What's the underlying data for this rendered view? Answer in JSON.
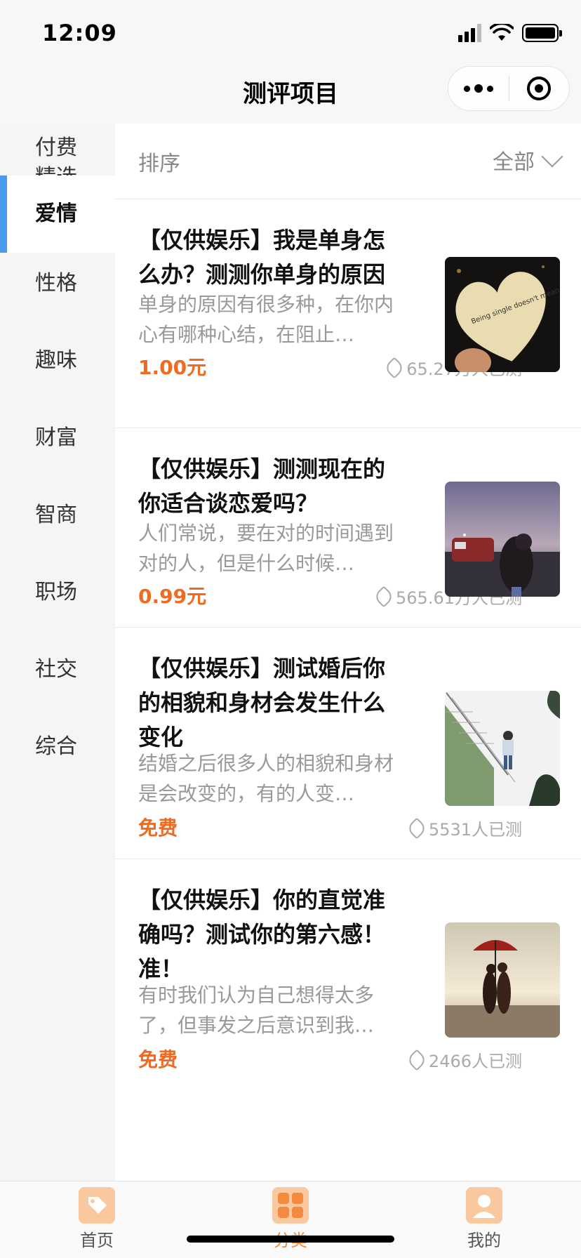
{
  "status_bar": {
    "time": "12:09"
  },
  "nav": {
    "title": "测评项目"
  },
  "sidebar": {
    "items": [
      {
        "label": "付费\n精选",
        "active": false
      },
      {
        "label": "爱情",
        "active": true
      },
      {
        "label": "性格",
        "active": false
      },
      {
        "label": "趣味",
        "active": false
      },
      {
        "label": "财富",
        "active": false
      },
      {
        "label": "智商",
        "active": false
      },
      {
        "label": "职场",
        "active": false
      },
      {
        "label": "社交",
        "active": false
      },
      {
        "label": "综合",
        "active": false
      }
    ]
  },
  "sort_bar": {
    "label": "排序",
    "filter": "全部"
  },
  "cards": [
    {
      "title": "【仅供娱乐】我是单身怎么办？测测你单身的原因",
      "desc": "单身的原因有很多种，在你内心有哪种心结，在阻止…",
      "price": "1.00元",
      "count": "65.27万人已测",
      "thumb": "heart-note",
      "thumb_text": "Being single doesn't mean you don't know anything about love. It just means you know enough to wait for it!"
    },
    {
      "title": "【仅供娱乐】测测现在的你适合谈恋爱吗？",
      "desc": "人们常说，要在对的时间遇到对的人，但是什么时候…",
      "price": "0.99元",
      "count": "565.61万人已测",
      "thumb": "couple-train"
    },
    {
      "title": "【仅供娱乐】测试婚后你的相貌和身材会发生什么变化",
      "desc": "结婚之后很多人的相貌和身材是会改变的，有的人变…",
      "price": "免费",
      "count": "5531人已测",
      "thumb": "girl-stairs"
    },
    {
      "title": "【仅供娱乐】你的直觉准确吗？测试你的第六感！准！",
      "desc": "有时我们认为自己想得太多了，但事发之后意识到我…",
      "price": "免费",
      "count": "2466人已测",
      "thumb": "beach-umbrella"
    }
  ],
  "tabbar": {
    "items": [
      {
        "label": "首页",
        "icon": "tag-icon",
        "active": false
      },
      {
        "label": "分类",
        "icon": "grid-icon",
        "active": true
      },
      {
        "label": "我的",
        "icon": "user-icon",
        "active": false
      }
    ]
  },
  "colors": {
    "accent": "#f06a1f",
    "active_bar": "#4a9bf0",
    "tab_icon_bg": "#f9c89e"
  }
}
